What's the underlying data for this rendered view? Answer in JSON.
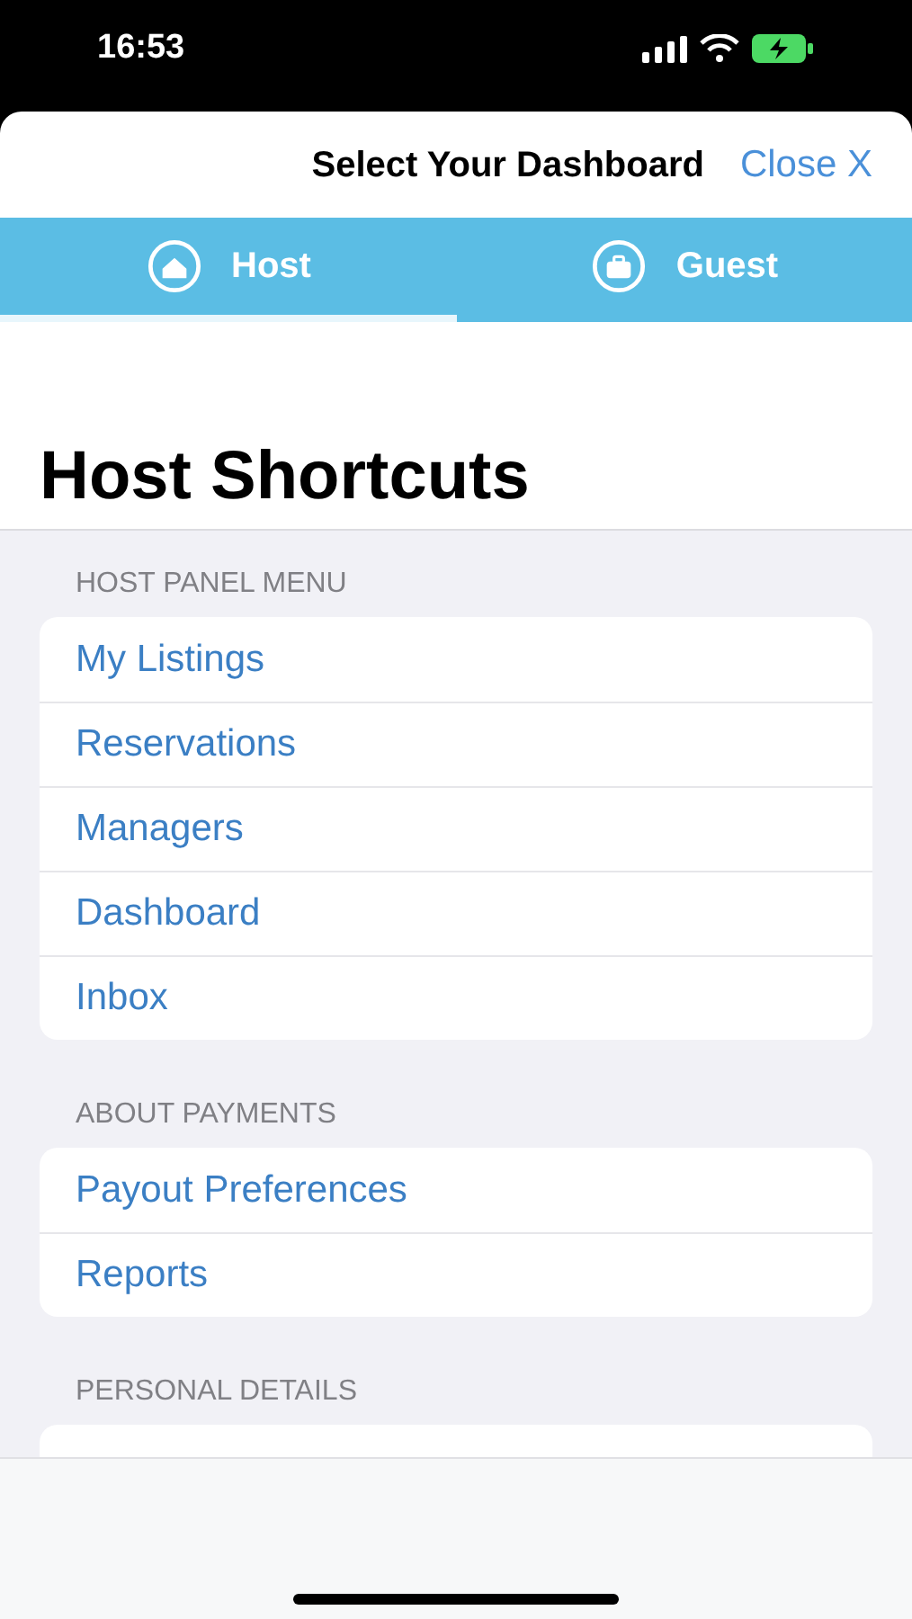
{
  "status_bar": {
    "time": "16:53"
  },
  "header": {
    "title": "Select Your Dashboard",
    "close": "Close X"
  },
  "tabs": [
    {
      "label": "Host",
      "selected": true
    },
    {
      "label": "Guest",
      "selected": false
    }
  ],
  "page_title": "Host Shortcuts",
  "sections": [
    {
      "heading": "HOST PANEL MENU",
      "items": [
        "My Listings",
        "Reservations",
        "Managers",
        "Dashboard",
        "Inbox"
      ]
    },
    {
      "heading": "ABOUT PAYMENTS",
      "items": [
        "Payout Preferences",
        "Reports"
      ]
    },
    {
      "heading": "PERSONAL DETAILS"
    }
  ]
}
